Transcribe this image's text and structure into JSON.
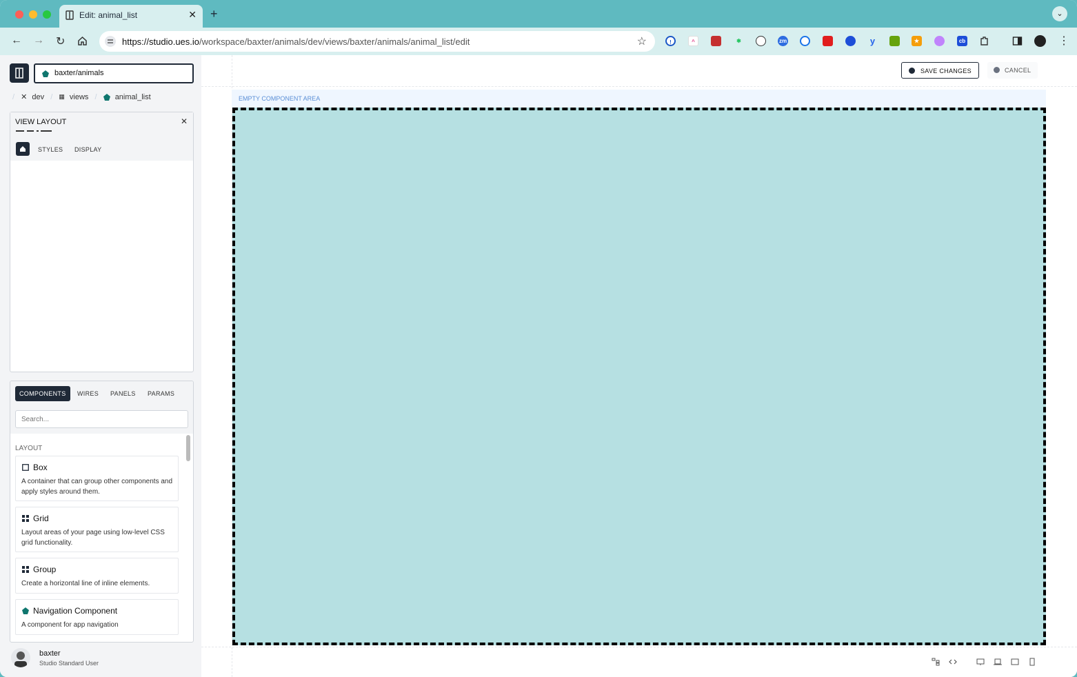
{
  "browser": {
    "tab_title": "Edit: animal_list",
    "url_host": "https://studio.ues.io",
    "url_path": "/workspace/baxter/animals/dev/views/baxter/animals/animal_list/edit",
    "new_tab_symbol": "+",
    "close_symbol": "✕",
    "extensions": [
      "1password-icon",
      "clickup-icon",
      "ext-red-icon",
      "ext-sparkle-icon",
      "ext-ghost-icon",
      "zoom-icon",
      "ext-blue-circle-icon",
      "acrobat-icon",
      "ext-pie-icon",
      "ext-y-icon",
      "ext-printer-icon",
      "ext-star-icon",
      "ext-color-icon",
      "coinbase-icon",
      "extensions-puzzle-icon"
    ],
    "ext_labels": {
      "zoom": "zm",
      "coinbase": "cb"
    }
  },
  "sidebar": {
    "workspace": "baxter/animals",
    "breadcrumbs": [
      {
        "label": "dev",
        "icon": "tools-icon"
      },
      {
        "label": "views",
        "icon": "grid-icon"
      },
      {
        "label": "animal_list",
        "icon": "pentagon-icon"
      }
    ],
    "view_panel": {
      "title": "VIEW LAYOUT",
      "close": "✕",
      "tabs": [
        "STYLES",
        "DISPLAY"
      ]
    },
    "components_panel": {
      "tabs": [
        "COMPONENTS",
        "WIRES",
        "PANELS",
        "PARAMS"
      ],
      "search_placeholder": "Search...",
      "section": "LAYOUT",
      "items": [
        {
          "name": "Box",
          "desc": "A container that can group other components and apply styles around them.",
          "icon": "square-icon"
        },
        {
          "name": "Grid",
          "desc": "Layout areas of your page using low-level CSS grid functionality.",
          "icon": "grid-icon"
        },
        {
          "name": "Group",
          "desc": "Create a horizontal line of inline elements.",
          "icon": "grid-icon"
        },
        {
          "name": "Navigation Component",
          "desc": "A component for app navigation",
          "icon": "pentagon-icon"
        }
      ]
    },
    "user": {
      "name": "baxter",
      "role": "Studio Standard User"
    }
  },
  "canvas": {
    "save_label": "SAVE CHANGES",
    "cancel_label": "CANCEL",
    "area_label": "EMPTY COMPONENT AREA",
    "drop_color": "#b6e0e2"
  },
  "colors": {
    "accent": "#5fbac0",
    "dark": "#1f2937",
    "teal": "#0f766e"
  }
}
